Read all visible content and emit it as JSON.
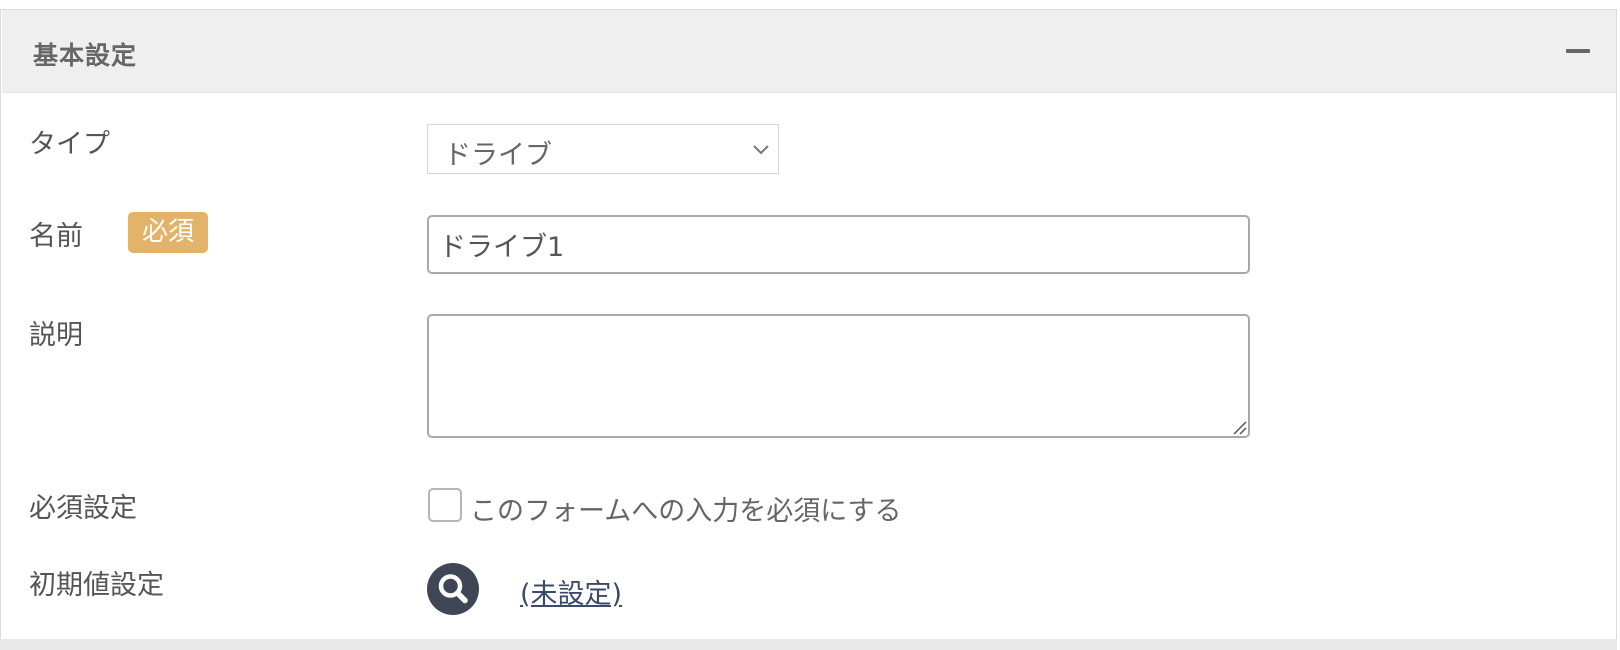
{
  "panel": {
    "title": "基本設定",
    "collapse_icon": "minus-icon"
  },
  "fields": {
    "type": {
      "label": "タイプ",
      "selected": "ドライブ"
    },
    "name": {
      "label": "名前",
      "required_badge": "必須",
      "value": "ドライブ1"
    },
    "description": {
      "label": "説明",
      "value": ""
    },
    "required_setting": {
      "label": "必須設定",
      "checkbox_label": "このフォームへの入力を必須にする",
      "checked": false
    },
    "default_value": {
      "label": "初期値設定",
      "icon": "search-icon",
      "link_text": "(未設定)"
    }
  },
  "colors": {
    "header_bg": "#efefef",
    "badge": "#e4b36a",
    "icon_dark": "#3f4757",
    "link": "#3a4a6a"
  }
}
